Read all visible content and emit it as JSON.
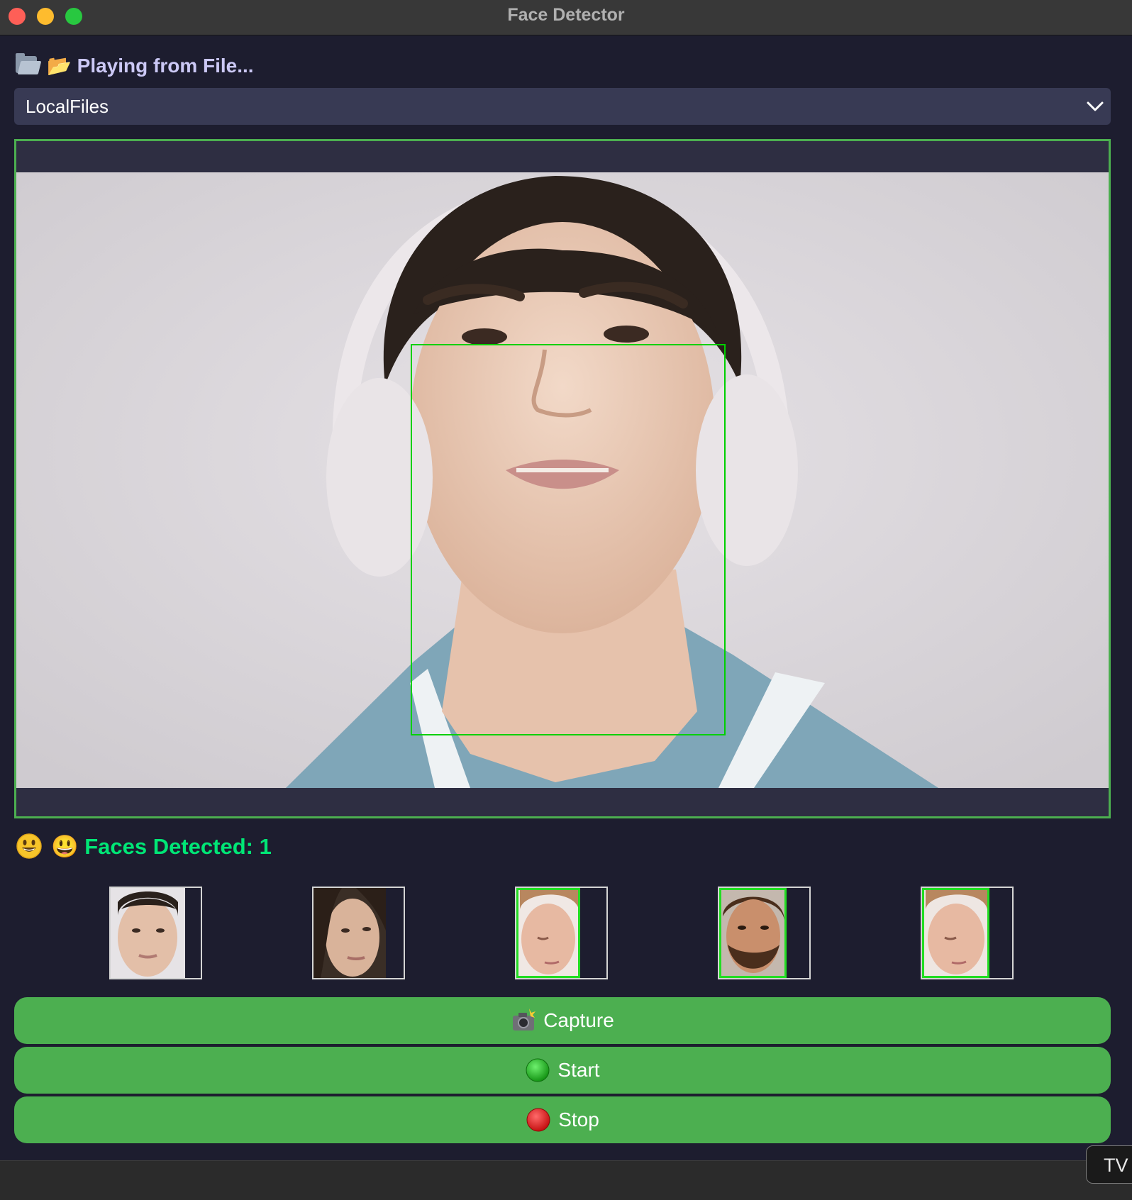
{
  "window": {
    "title": "Face Detector"
  },
  "status": {
    "icon": "folder-icon",
    "text": "📂 Playing from File..."
  },
  "source_select": {
    "selected": "LocalFiles"
  },
  "detection": {
    "icon": "smiley-icon",
    "text": "😃 Faces Detected: 1",
    "count": 1,
    "box_color": "#00d000"
  },
  "captured_faces": [
    {
      "name": "face-thumbnail-1",
      "highlighted": false
    },
    {
      "name": "face-thumbnail-2",
      "highlighted": false
    },
    {
      "name": "face-thumbnail-3",
      "highlighted": true
    },
    {
      "name": "face-thumbnail-4",
      "highlighted": true
    },
    {
      "name": "face-thumbnail-5",
      "highlighted": true
    }
  ],
  "buttons": {
    "capture": {
      "icon": "camera-flash-icon",
      "label": "Capture"
    },
    "start": {
      "icon": "green-circle-icon",
      "label": "Start"
    },
    "stop": {
      "icon": "red-circle-icon",
      "label": "Stop"
    }
  },
  "tooltip": {
    "text": "TV"
  },
  "colors": {
    "background": "#1d1d2f",
    "accent_green": "#4caf50",
    "detected_text": "#00e676",
    "status_text": "#cbc8f5"
  }
}
